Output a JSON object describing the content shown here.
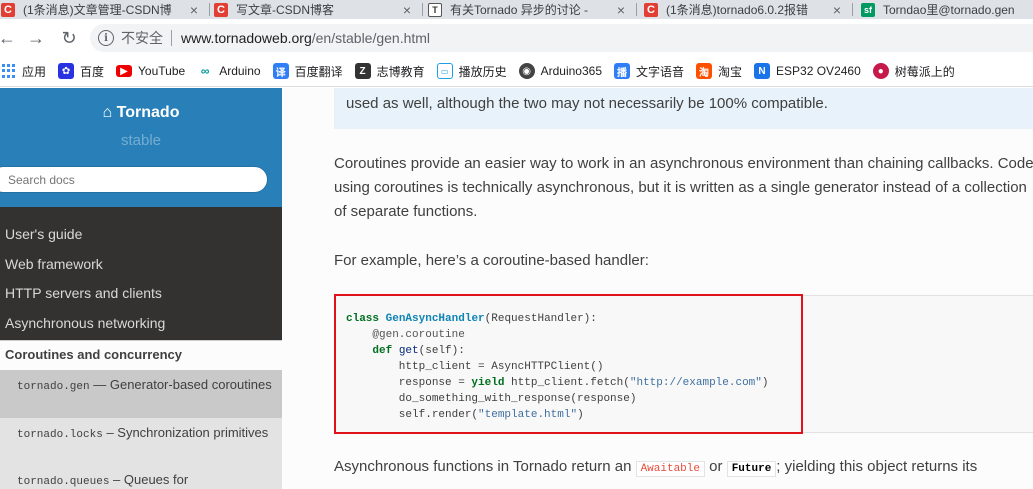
{
  "tabs": [
    {
      "icon": "C",
      "title": "(1条消息)文章管理-CSDN博"
    },
    {
      "icon": "C",
      "title": "写文章-CSDN博客"
    },
    {
      "icon": "T",
      "title": "有关Tornado 异步的讨论 -"
    },
    {
      "icon": "C",
      "title": "(1条消息)tornado6.0.2报错"
    },
    {
      "icon": "sf",
      "title": "Torndao里@tornado.gen"
    }
  ],
  "address": {
    "security_label": "不安全",
    "host": "www.tornadoweb.org",
    "path": "/en/stable/gen.html"
  },
  "bookmarks": [
    "应用",
    "百度",
    "YouTube",
    "Arduino",
    "百度翻译",
    "志博教育",
    "播放历史",
    "Arduino365",
    "文字语音",
    "淘宝",
    "ESP32 OV2460",
    "树莓派上的"
  ],
  "sidebar": {
    "brand": "Tornado",
    "version": "stable",
    "search_placeholder": "Search docs",
    "items": [
      "User's guide",
      "Web framework",
      "HTTP servers and clients",
      "Asynchronous networking"
    ],
    "current": "Coroutines and concurrency",
    "subitems": [
      {
        "code": "tornado.gen",
        "text": " — Generator-based coroutines"
      },
      {
        "code": "tornado.locks",
        "text": " – Synchronization primitives"
      },
      {
        "code": "tornado.queues",
        "text": " – Queues for"
      }
    ]
  },
  "content": {
    "note_tail": "used as well, although the two may not necessarily be 100% compatible.",
    "para1": "Coroutines provide an easier way to work in an asynchronous environment than chaining callbacks. Code using coroutines is technically asynchronous, but it is written as a single generator instead of a collection of separate functions.",
    "para2": "For example, here’s a coroutine-based handler:",
    "last_pre": "Asynchronous functions in Tornado return an ",
    "awaitable": "Awaitable",
    "or": " or ",
    "future": "Future",
    "last_post": "; yielding this object returns its"
  },
  "colors": {
    "sidebar_header": "#2980b9",
    "sidebar_bg": "#343131",
    "highlight_border": "#e0131a",
    "note_bg": "#e7f2fa"
  }
}
